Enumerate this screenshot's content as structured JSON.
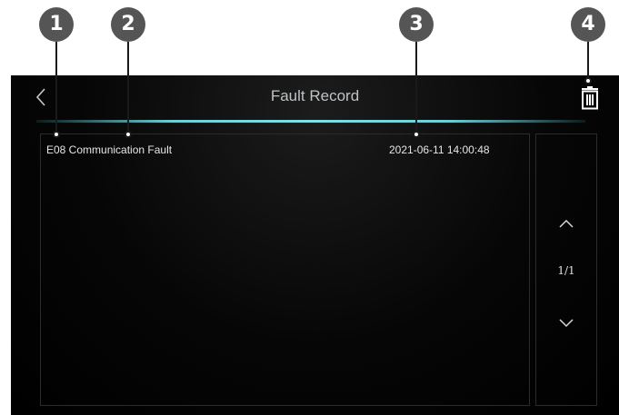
{
  "callouts": [
    "1",
    "2",
    "3",
    "4"
  ],
  "screen": {
    "title": "Fault Record",
    "back_icon": "chevron-left-icon",
    "delete_icon": "trash-icon",
    "records": [
      {
        "name": "E08 Communication Fault",
        "time": "2021-06-11 14:00:48"
      }
    ],
    "pagination": {
      "up_icon": "chevron-up-icon",
      "indicator": "1/1",
      "down_icon": "chevron-down-icon"
    }
  },
  "colors": {
    "accent_line": "#6bd0d6",
    "callout_bg": "#555555",
    "screen_bg": "#000000"
  }
}
